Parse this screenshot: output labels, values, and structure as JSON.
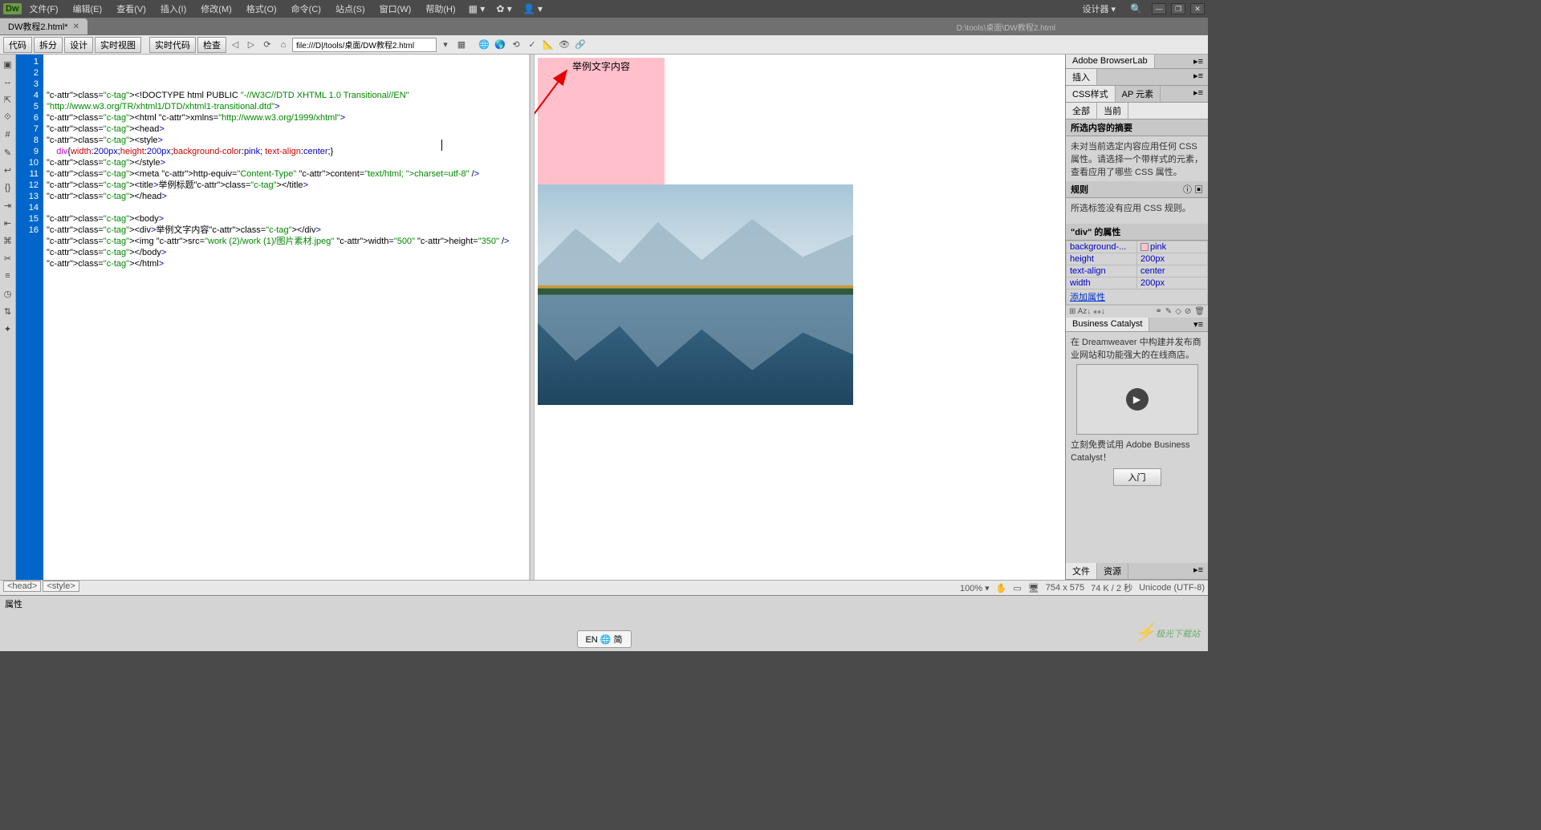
{
  "app": {
    "logo": "Dw"
  },
  "menu": {
    "file": "文件(F)",
    "edit": "编辑(E)",
    "view": "查看(V)",
    "insert": "插入(I)",
    "modify": "修改(M)",
    "format": "格式(O)",
    "commands": "命令(C)",
    "site": "站点(S)",
    "window": "窗口(W)",
    "help": "帮助(H)"
  },
  "workspace": {
    "label": "设计器",
    "search_icon": "🔍"
  },
  "window_buttons": {
    "min": "—",
    "max": "❐",
    "close": "✕"
  },
  "tabs": {
    "file_name": "DW教程2.html*",
    "path": "D:\\tools\\桌面\\DW教程2.html"
  },
  "toolbar": {
    "code": "代码",
    "split": "拆分",
    "design": "设计",
    "live": "实时视图",
    "live_code": "实时代码",
    "check": "检查",
    "url": "file:///D|/tools/桌面/DW教程2.html"
  },
  "code": {
    "lines": [
      "<!DOCTYPE html PUBLIC \"-//W3C//DTD XHTML 1.0 Transitional//EN\"",
      "\"http://www.w3.org/TR/xhtml1/DTD/xhtml1-transitional.dtd\">",
      "<html xmlns=\"http://www.w3.org/1999/xhtml\">",
      "<head>",
      "<style>",
      "    div{width:200px;height:200px;background-color:pink; text-align:center;}",
      "</style>",
      "<meta http-equiv=\"Content-Type\" content=\"text/html; charset=utf-8\" />",
      "<title>举例标题</title>",
      "</head>",
      "",
      "<body>",
      "<div>举例文字内容</div>",
      "<img src=\"work (2)/work (1)/图片素材.jpeg\" width=\"500\" height=\"350\" />",
      "</body>",
      "</html>",
      ""
    ]
  },
  "preview": {
    "box_text": "举例文字内容"
  },
  "panels": {
    "browserlab": "Adobe BrowserLab",
    "insert": "插入",
    "css_styles": "CSS样式",
    "ap_elements": "AP 元素",
    "all": "全部",
    "current": "当前",
    "summary_title": "所选内容的摘要",
    "summary_text": "未对当前选定内容应用任何 CSS 属性。请选择一个带样式的元素，查看应用了哪些 CSS 属性。",
    "rules_title": "规则",
    "rules_text": "所选标签没有应用 CSS 规则。",
    "props_title": "\"div\" 的属性",
    "props": [
      {
        "k": "background-...",
        "v": "pink",
        "swatch": true
      },
      {
        "k": "height",
        "v": "200px"
      },
      {
        "k": "text-align",
        "v": "center"
      },
      {
        "k": "width",
        "v": "200px"
      }
    ],
    "add_prop": "添加属性",
    "bc_title": "Business Catalyst",
    "bc_text1": "在 Dreamweaver 中构建并发布商业网站和功能强大的在线商店。",
    "bc_text2": "立刻免费试用 Adobe Business Catalyst！",
    "bc_button": "入门",
    "files": "文件",
    "assets": "资源"
  },
  "tag_path": {
    "head": "<head>",
    "style": "<style>"
  },
  "status": {
    "zoom": "100%",
    "dims": "754 x 575",
    "size_time": "74 K / 2 秒",
    "encoding": "Unicode (UTF-8)"
  },
  "properties_panel": {
    "title": "属性"
  },
  "ime": "EN 🌐 简",
  "watermark": "极光下载站"
}
